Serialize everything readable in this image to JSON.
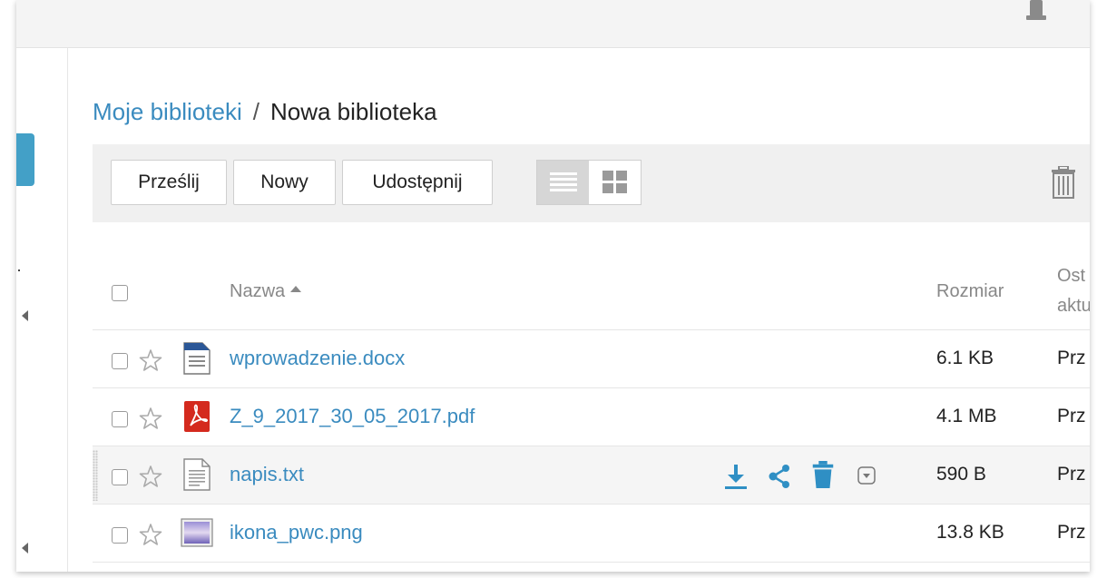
{
  "breadcrumb": {
    "root": "Moje biblioteki",
    "separator": "/",
    "current": "Nowa biblioteka"
  },
  "toolbar": {
    "upload_label": "Prześlij",
    "new_label": "Nowy",
    "share_label": "Udostępnij",
    "view_mode": "list"
  },
  "table": {
    "headers": {
      "name": "Nazwa",
      "size": "Rozmiar",
      "modified_line1": "Ost",
      "modified_line2": "aktu"
    },
    "sort_column": "name",
    "sort_direction": "ascending",
    "rows": [
      {
        "name": "wprowadzenie.docx",
        "size": "6.1 KB",
        "modified": "Prz",
        "type": "docx-icon"
      },
      {
        "name": "Z_9_2017_30_05_2017.pdf",
        "size": "4.1 MB",
        "modified": "Prz",
        "type": "pdf-icon"
      },
      {
        "name": "napis.txt",
        "size": "590 B",
        "modified": "Prz",
        "type": "txt-icon",
        "hovered": true
      },
      {
        "name": "ikona_pwc.png",
        "size": "13.8 KB",
        "modified": "Prz",
        "type": "image-icon"
      }
    ]
  },
  "colors": {
    "accent": "#3a8bbf",
    "action_icon": "#2f8fc4",
    "pdf_red": "#d42a1e",
    "docx_blue": "#2b5797"
  }
}
